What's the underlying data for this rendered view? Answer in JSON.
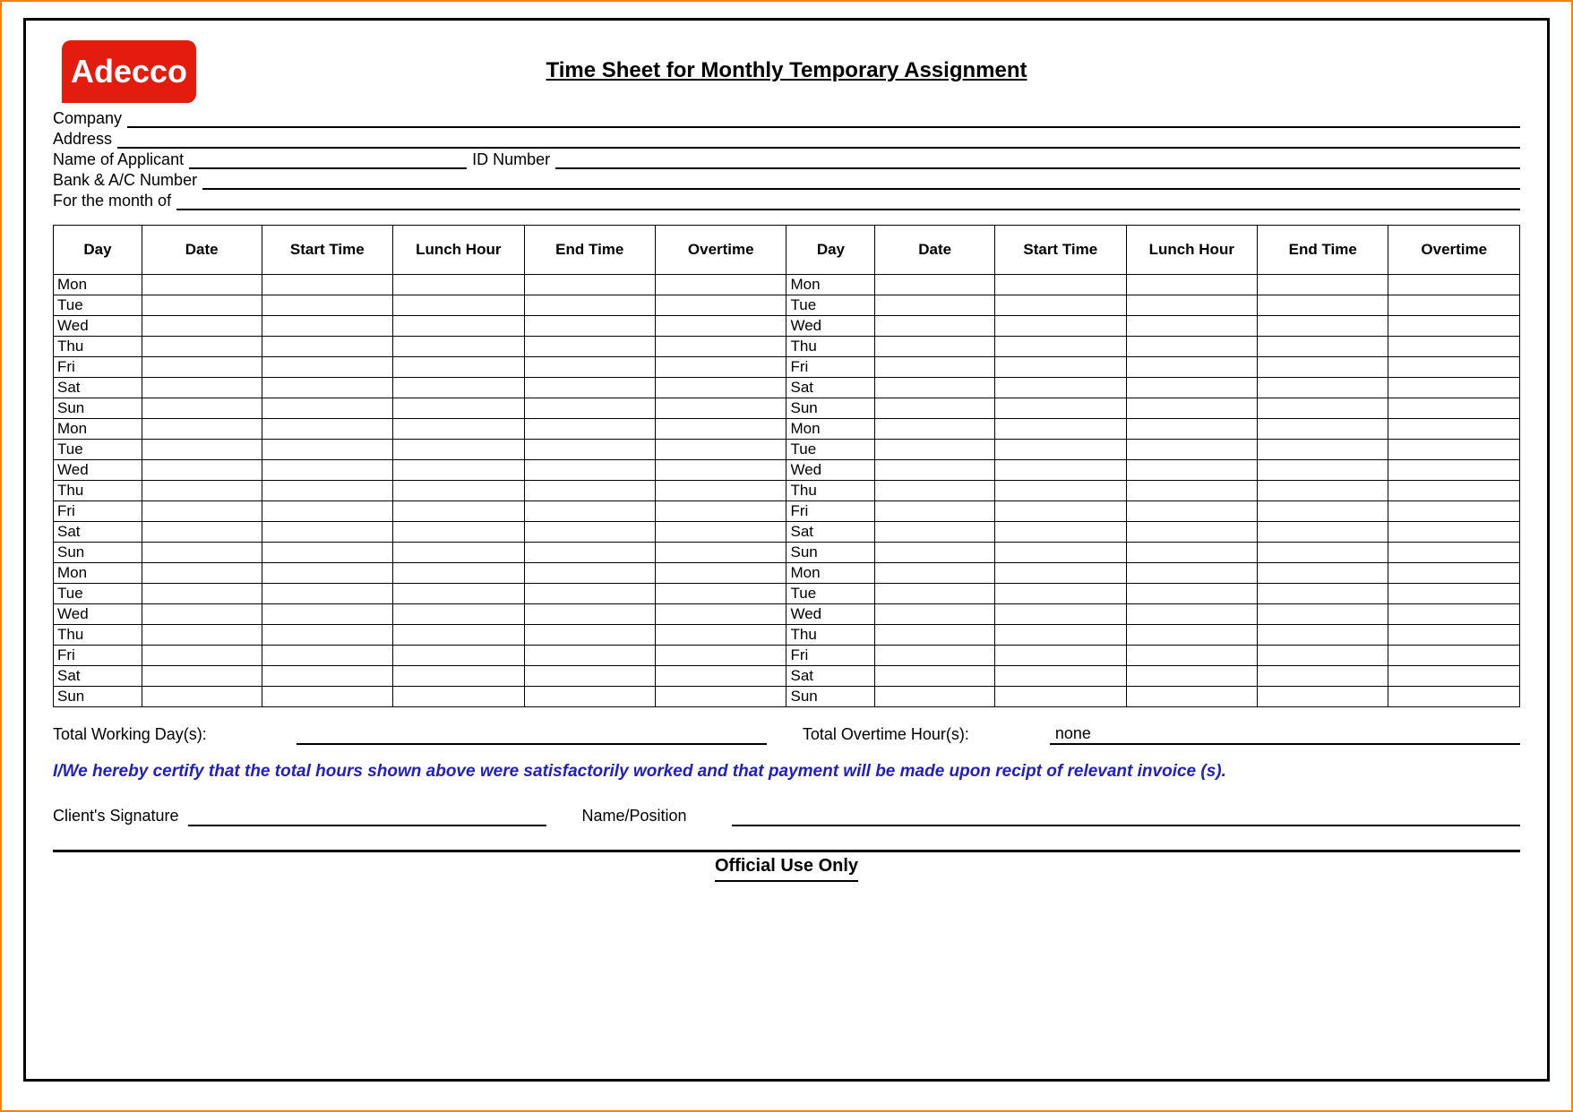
{
  "logo_text": "Adecco",
  "title": "Time Sheet for Monthly Temporary Assignment",
  "fields": {
    "company": "Company",
    "address": "Address",
    "applicant": "Name of Applicant",
    "id_number": "ID Number",
    "bank": "Bank & A/C Number",
    "month": "For the month of"
  },
  "columns": {
    "day": "Day",
    "date": "Date",
    "start": "Start Time",
    "lunch": "Lunch Hour",
    "end": "End Time",
    "overtime": "Overtime"
  },
  "days": [
    "Mon",
    "Tue",
    "Wed",
    "Thu",
    "Fri",
    "Sat",
    "Sun",
    "Mon",
    "Tue",
    "Wed",
    "Thu",
    "Fri",
    "Sat",
    "Sun",
    "Mon",
    "Tue",
    "Wed",
    "Thu",
    "Fri",
    "Sat",
    "Sun"
  ],
  "summary": {
    "twd": "Total Working Day(s):",
    "twd_value": "",
    "toh": "Total Overtime Hour(s):",
    "toh_value": "none"
  },
  "certify": "I/We hereby certify that the total hours shown above were satisfactorily worked and that payment will be made upon recipt of relevant invoice (s).",
  "signature": {
    "client": "Client's Signature",
    "name_pos": "Name/Position"
  },
  "official": "Official Use Only"
}
